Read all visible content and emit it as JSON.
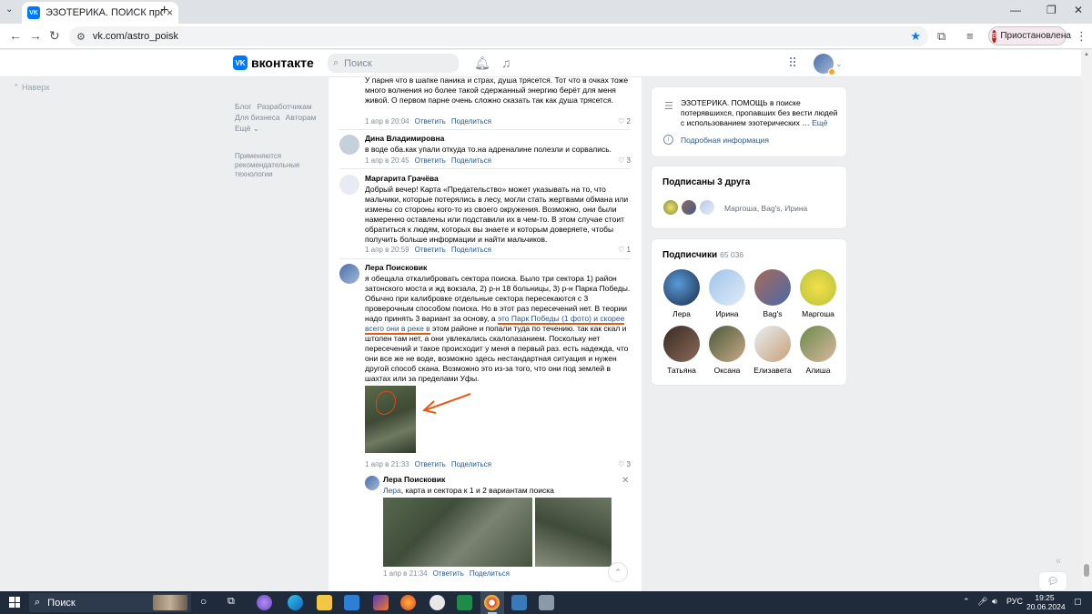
{
  "browser": {
    "tab_title": "ЭЗОТЕРИКА. ПОИСК пропавш",
    "tab_favicon": "vk",
    "url": "vk.com/astro_poisk",
    "profile_initial": "В",
    "profile_label": "Приостановлена"
  },
  "vk": {
    "logo_text": "вконтакте",
    "logo_mark": "vk",
    "search_placeholder": "Поиск"
  },
  "leftnav": {
    "back_label": "Наверх",
    "links": [
      "Блог",
      "Разработчикам",
      "Для бизнеса",
      "Авторам",
      "Ещё ⌄"
    ],
    "rec_note": "Применяются рекомендательные технологии"
  },
  "comments": [
    {
      "author": "",
      "text": "У парня что в шапке паника и страх, душа трясется. Тот что в очках тоже много волнения но более такой сдержанный энергию берёт для меня живой. О первом парне очень сложно сказать так как душа трясется.",
      "date": "1 апр в 20:04",
      "reply": "Ответить",
      "share": "Поделиться",
      "likes": "2"
    },
    {
      "author": "Дина Владимировна",
      "text": "в воде оба.как упали откуда то.на адреналине полезли и сорвались.",
      "date": "1 апр в 20:45",
      "reply": "Ответить",
      "share": "Поделиться",
      "likes": "3"
    },
    {
      "author": "Маргарита Грачёва",
      "text": "Добрый вечер! Карта «Предательство» может указывать на то, что мальчики, которые потерялись в лесу, могли стать жертвами обмана или измены со стороны кого-то из своего окружения. Возможно, они были намеренно оставлены или подставили их в чем-то. В этом случае стоит обратиться к людям, которых вы знаете и которым доверяете, чтобы получить больше информации и найти мальчиков.",
      "date": "1 апр в 20:59",
      "reply": "Ответить",
      "share": "Поделиться",
      "likes": "1"
    },
    {
      "author": "Лера Поисковик",
      "text_before": "я обещала откалибровать сектора поиска. Было три сектора 1) район затонского моста и жд вокзала, 2) р-н 18 больницы, 3) р-н Парка Победы. Обычно при калибровке отдельные сектора пересекаются с 3 проверочным способом поиска. Но в этот раз пересечений нет. В теории надо принять 3 вариант за основу, а ",
      "text_highlight": "это Парк Победы (1 фото) и скорее всего они в реке в",
      "text_after": " этом районе и попали туда по течению. так как скал и штолен там нет, а они увлекались скалолазанием. Поскольку нет пересечений и такое происходит у меня в первый раз. есть надежда, что они все же не воде, возможно здесь нестандартная ситуация и нужен другой способ скана. Возможно это из-за того, что они под землей в шахтах или за пределами Уфы.",
      "date": "1 апр в 21:33",
      "reply": "Ответить",
      "share": "Поделиться",
      "likes": "3"
    }
  ],
  "reply": {
    "author": "Лера Поисковик",
    "mention": "Лера",
    "text": ", карта и сектора к 1 и 2 вариантам поиска",
    "date": "1 апр в 21:34",
    "reply_label": "Ответить",
    "share_label": "Поделиться"
  },
  "group_info": {
    "description": "ЭЗОТЕРИКА. ПОМОЩЬ в поиске потерявшихся, пропавших без вести людей с использованием эзотерических …",
    "more": "Ещё",
    "details": "Подробная информация"
  },
  "friends": {
    "title": "Подписаны 3 друга",
    "names": "Маргоша, Bag's, Ирина"
  },
  "subscribers": {
    "title": "Подписчики",
    "count": "65 036",
    "people": [
      "Лера",
      "Ирина",
      "Bag's",
      "Маргоша",
      "Татьяна",
      "Оксана",
      "Елизавета",
      "Алиша"
    ]
  },
  "taskbar": {
    "search_label": "Поиск",
    "lang": "РУС",
    "time": "19:25",
    "date": "20.06.2024"
  },
  "colors": {
    "vk_blue": "#0077ff",
    "link": "#2a5885",
    "annotation_orange": "#e55b13"
  }
}
